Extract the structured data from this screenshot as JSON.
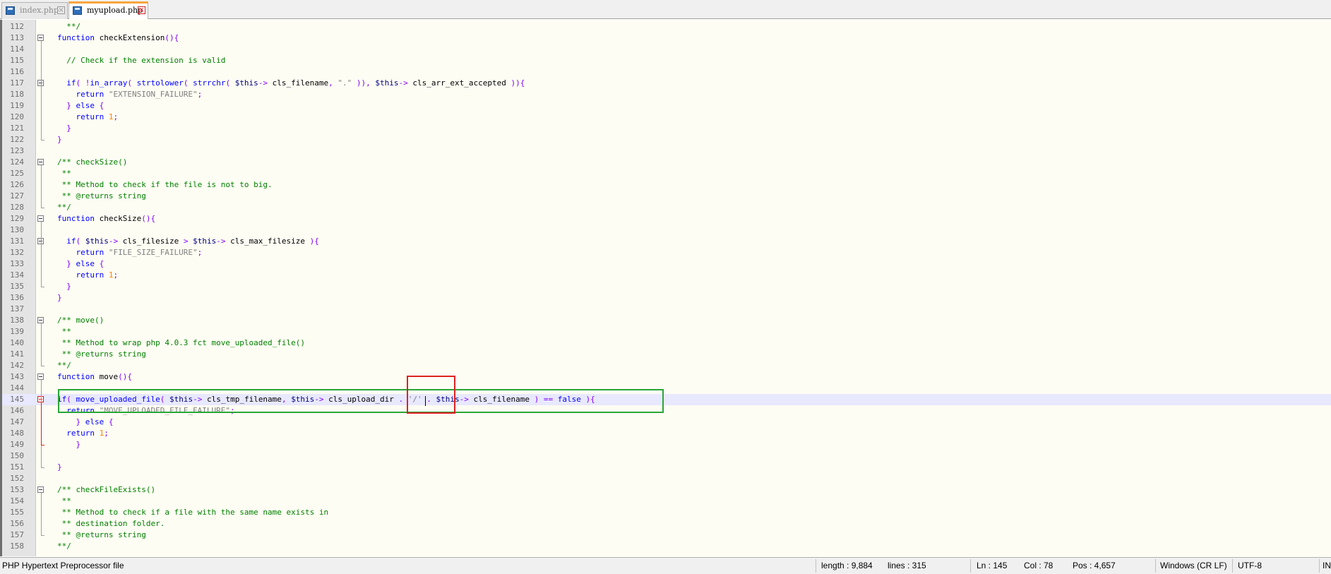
{
  "tabs": [
    {
      "label": "index.php",
      "close": "×"
    },
    {
      "label": "myupload.php",
      "close": "×"
    }
  ],
  "lines": [
    {
      "n": "112",
      "tokens": [
        [
          "",
          "  **/"
        ]
      ],
      "cls": "cm"
    },
    {
      "n": "113",
      "tokens": [
        [
          "kw",
          "function"
        ],
        [
          "",
          "checkExtension"
        ],
        [
          "op",
          "(){"
        ]
      ]
    },
    {
      "n": "114",
      "tokens": []
    },
    {
      "n": "115",
      "tokens": [
        [
          "cm",
          "// Check if the extension is valid"
        ]
      ]
    },
    {
      "n": "116",
      "tokens": []
    },
    {
      "n": "117",
      "tokens": [
        [
          "kw",
          "if"
        ],
        [
          "op",
          "( !"
        ],
        [
          "kw",
          "in_array"
        ],
        [
          "op",
          "( "
        ],
        [
          "kw",
          "strtolower"
        ],
        [
          "op",
          "( "
        ],
        [
          "kw",
          "strrchr"
        ],
        [
          "op",
          "( "
        ],
        [
          "var",
          "$this"
        ],
        [
          "op",
          "->"
        ],
        [
          "",
          "cls_filename"
        ],
        [
          "op",
          ", "
        ],
        [
          "str",
          "\".\""
        ],
        [
          "op",
          " )), "
        ],
        [
          "var",
          "$this"
        ],
        [
          "op",
          "->"
        ],
        [
          "",
          "cls_arr_ext_accepted"
        ],
        [
          "op",
          " )){"
        ]
      ]
    },
    {
      "n": "118",
      "tokens": [
        [
          "kw",
          "return"
        ],
        [
          "str",
          " \"EXTENSION_FAILURE\""
        ],
        [
          "op",
          ";"
        ]
      ]
    },
    {
      "n": "119",
      "tokens": [
        [
          "op",
          "} "
        ],
        [
          "kw",
          "else"
        ],
        [
          "op",
          " {"
        ]
      ]
    },
    {
      "n": "120",
      "tokens": [
        [
          "kw",
          "return"
        ],
        [
          "num",
          " 1"
        ],
        [
          "op",
          ";"
        ]
      ]
    },
    {
      "n": "121",
      "tokens": [
        [
          "op",
          "}"
        ]
      ]
    },
    {
      "n": "122",
      "tokens": [
        [
          "op",
          "}"
        ]
      ]
    },
    {
      "n": "123",
      "tokens": []
    },
    {
      "n": "124",
      "tokens": [
        [
          "cm",
          "/** checkSize()"
        ]
      ]
    },
    {
      "n": "125",
      "tokens": [
        [
          "cm",
          " **"
        ]
      ]
    },
    {
      "n": "126",
      "tokens": [
        [
          "cm",
          " ** Method to check if the file is not to big."
        ]
      ]
    },
    {
      "n": "127",
      "tokens": [
        [
          "cm",
          " ** @returns string"
        ]
      ]
    },
    {
      "n": "128",
      "tokens": [
        [
          "cm",
          "**/"
        ]
      ]
    },
    {
      "n": "129",
      "tokens": [
        [
          "kw",
          "function"
        ],
        [
          "",
          "checkSize"
        ],
        [
          "op",
          "(){"
        ]
      ]
    },
    {
      "n": "130",
      "tokens": []
    },
    {
      "n": "131",
      "tokens": [
        [
          "kw",
          "if"
        ],
        [
          "op",
          "( "
        ],
        [
          "var",
          "$this"
        ],
        [
          "op",
          "->"
        ],
        [
          "",
          "cls_filesize"
        ],
        [
          "op",
          " > "
        ],
        [
          "var",
          "$this"
        ],
        [
          "op",
          "->"
        ],
        [
          "",
          "cls_max_filesize"
        ],
        [
          "op",
          " ){"
        ]
      ]
    },
    {
      "n": "132",
      "tokens": [
        [
          "kw",
          "return"
        ],
        [
          "str",
          " \"FILE_SIZE_FAILURE\""
        ],
        [
          "op",
          ";"
        ]
      ]
    },
    {
      "n": "133",
      "tokens": [
        [
          "op",
          "} "
        ],
        [
          "kw",
          "else"
        ],
        [
          "op",
          " {"
        ]
      ]
    },
    {
      "n": "134",
      "tokens": [
        [
          "kw",
          "return"
        ],
        [
          "num",
          " 1"
        ],
        [
          "op",
          ";"
        ]
      ]
    },
    {
      "n": "135",
      "tokens": [
        [
          "op",
          "}"
        ]
      ]
    },
    {
      "n": "136",
      "tokens": [
        [
          "op",
          "}"
        ]
      ]
    },
    {
      "n": "137",
      "tokens": []
    },
    {
      "n": "138",
      "tokens": [
        [
          "cm",
          "/** move()"
        ]
      ]
    },
    {
      "n": "139",
      "tokens": [
        [
          "cm",
          " **"
        ]
      ]
    },
    {
      "n": "140",
      "tokens": [
        [
          "cm",
          " ** Method to wrap php 4.0.3 fct move_uploaded_file()"
        ]
      ]
    },
    {
      "n": "141",
      "tokens": [
        [
          "cm",
          " ** @returns string"
        ]
      ]
    },
    {
      "n": "142",
      "tokens": [
        [
          "cm",
          "**/"
        ]
      ]
    },
    {
      "n": "143",
      "tokens": [
        [
          "kw",
          "function"
        ],
        [
          "",
          "move"
        ],
        [
          "op",
          "(){"
        ]
      ]
    },
    {
      "n": "144",
      "tokens": []
    },
    {
      "n": "145",
      "tokens": [
        [
          "kw",
          "if"
        ],
        [
          "op",
          "( "
        ],
        [
          "kw",
          "move_uploaded_file"
        ],
        [
          "op",
          "( "
        ],
        [
          "var",
          "$this"
        ],
        [
          "op",
          "->"
        ],
        [
          "",
          "cls_tmp_filename"
        ],
        [
          "op",
          ", "
        ],
        [
          "var",
          "$this"
        ],
        [
          "op",
          "->"
        ],
        [
          "",
          "cls_upload_dir"
        ],
        [
          "op",
          " . "
        ],
        [
          "str",
          "'/'"
        ],
        [
          "op",
          " . "
        ],
        [
          "var",
          "$this"
        ],
        [
          "op",
          "->"
        ],
        [
          "",
          "cls_filename"
        ],
        [
          "op",
          " ) == "
        ],
        [
          "kw",
          "false"
        ],
        [
          "op",
          " ){"
        ]
      ]
    },
    {
      "n": "146",
      "tokens": [
        [
          "kw",
          "return"
        ],
        [
          "str",
          " \"MOVE_UPLOADED_FILE_FAILURE\""
        ],
        [
          "op",
          ";"
        ]
      ]
    },
    {
      "n": "147",
      "tokens": [
        [
          "op",
          "} "
        ],
        [
          "kw",
          "else"
        ],
        [
          "op",
          " {"
        ]
      ]
    },
    {
      "n": "148",
      "tokens": [
        [
          "kw",
          "return"
        ],
        [
          "num",
          " 1"
        ],
        [
          "op",
          ";"
        ]
      ]
    },
    {
      "n": "149",
      "tokens": [
        [
          "op",
          "}"
        ]
      ]
    },
    {
      "n": "150",
      "tokens": []
    },
    {
      "n": "151",
      "tokens": [
        [
          "op",
          "}"
        ]
      ]
    },
    {
      "n": "152",
      "tokens": []
    },
    {
      "n": "153",
      "tokens": [
        [
          "cm",
          "/** checkFileExists()"
        ]
      ]
    },
    {
      "n": "154",
      "tokens": [
        [
          "cm",
          " **"
        ]
      ]
    },
    {
      "n": "155",
      "tokens": [
        [
          "cm",
          " ** Method to check if a file with the same name exists in"
        ]
      ]
    },
    {
      "n": "156",
      "tokens": [
        [
          "cm",
          " ** destination folder."
        ]
      ]
    },
    {
      "n": "157",
      "tokens": [
        [
          "cm",
          " ** @returns string"
        ]
      ]
    },
    {
      "n": "158",
      "tokens": [
        [
          "cm",
          "**/"
        ]
      ]
    }
  ],
  "status": {
    "filetype": "PHP Hypertext Preprocessor file",
    "length": "length : 9,884",
    "lines": "lines : 315",
    "ln": "Ln : 145",
    "col": "Col : 78",
    "pos": "Pos : 4,657",
    "eol": "Windows (CR LF)",
    "encoding": "UTF-8",
    "mode": "IN"
  }
}
